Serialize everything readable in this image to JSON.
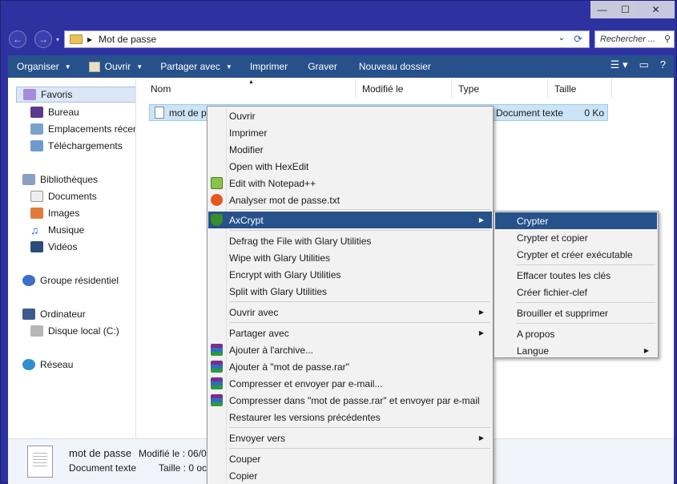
{
  "window": {
    "caption_min": "—",
    "caption_max": "☐",
    "caption_close": "✕"
  },
  "address": {
    "path": "Mot de passe",
    "search_placeholder": "Rechercher ..."
  },
  "toolbar": {
    "items": [
      "Organiser",
      "Ouvrir",
      "Partager avec",
      "Imprimer",
      "Graver",
      "Nouveau dossier"
    ]
  },
  "sidebar": {
    "favorites": "Favoris",
    "fav_items": [
      "Bureau",
      "Emplacements récents",
      "Téléchargements"
    ],
    "libraries": "Bibliothèques",
    "lib_items": [
      "Documents",
      "Images",
      "Musique",
      "Vidéos"
    ],
    "homegroup": "Groupe résidentiel",
    "computer": "Ordinateur",
    "computer_items": [
      "Disque local (C:)"
    ],
    "network": "Réseau"
  },
  "columns": [
    "Nom",
    "Modifié le",
    "Type",
    "Taille"
  ],
  "file": {
    "name": "mot de passe",
    "type": "Document texte",
    "size": "0 Ko"
  },
  "details": {
    "name": "mot de passe",
    "type": "Document texte",
    "modified": "Modifié le : 06/0",
    "size": "Taille : 0 oc"
  },
  "context_menu": {
    "items": [
      "Ouvrir",
      "Imprimer",
      "Modifier",
      "Open with HexEdit",
      "Edit with Notepad++",
      "Analyser mot de passe.txt",
      "AxCrypt",
      "Defrag the File with Glary Utilities",
      "Wipe with Glary Utilities",
      "Encrypt with Glary Utilities",
      "Split with Glary Utilities",
      "Ouvrir avec",
      "Partager avec",
      "Ajouter à l'archive...",
      "Ajouter à \"mot de passe.rar\"",
      "Compresser et envoyer par e-mail...",
      "Compresser dans \"mot de passe.rar\" et envoyer par e-mail",
      "Restaurer les versions précédentes",
      "Envoyer vers",
      "Couper",
      "Copier"
    ]
  },
  "axcrypt_menu": {
    "items": [
      "Crypter",
      "Crypter et copier",
      "Crypter et créer exécutable",
      "Effacer toutes les clés",
      "Créer fichier-clef",
      "Brouiller et supprimer",
      "A propos",
      "Langue"
    ]
  },
  "colors": {
    "window_frame": "#2d32a0",
    "toolbar": "#27518a",
    "highlight": "#27518a",
    "selection": "#cce4f7"
  }
}
